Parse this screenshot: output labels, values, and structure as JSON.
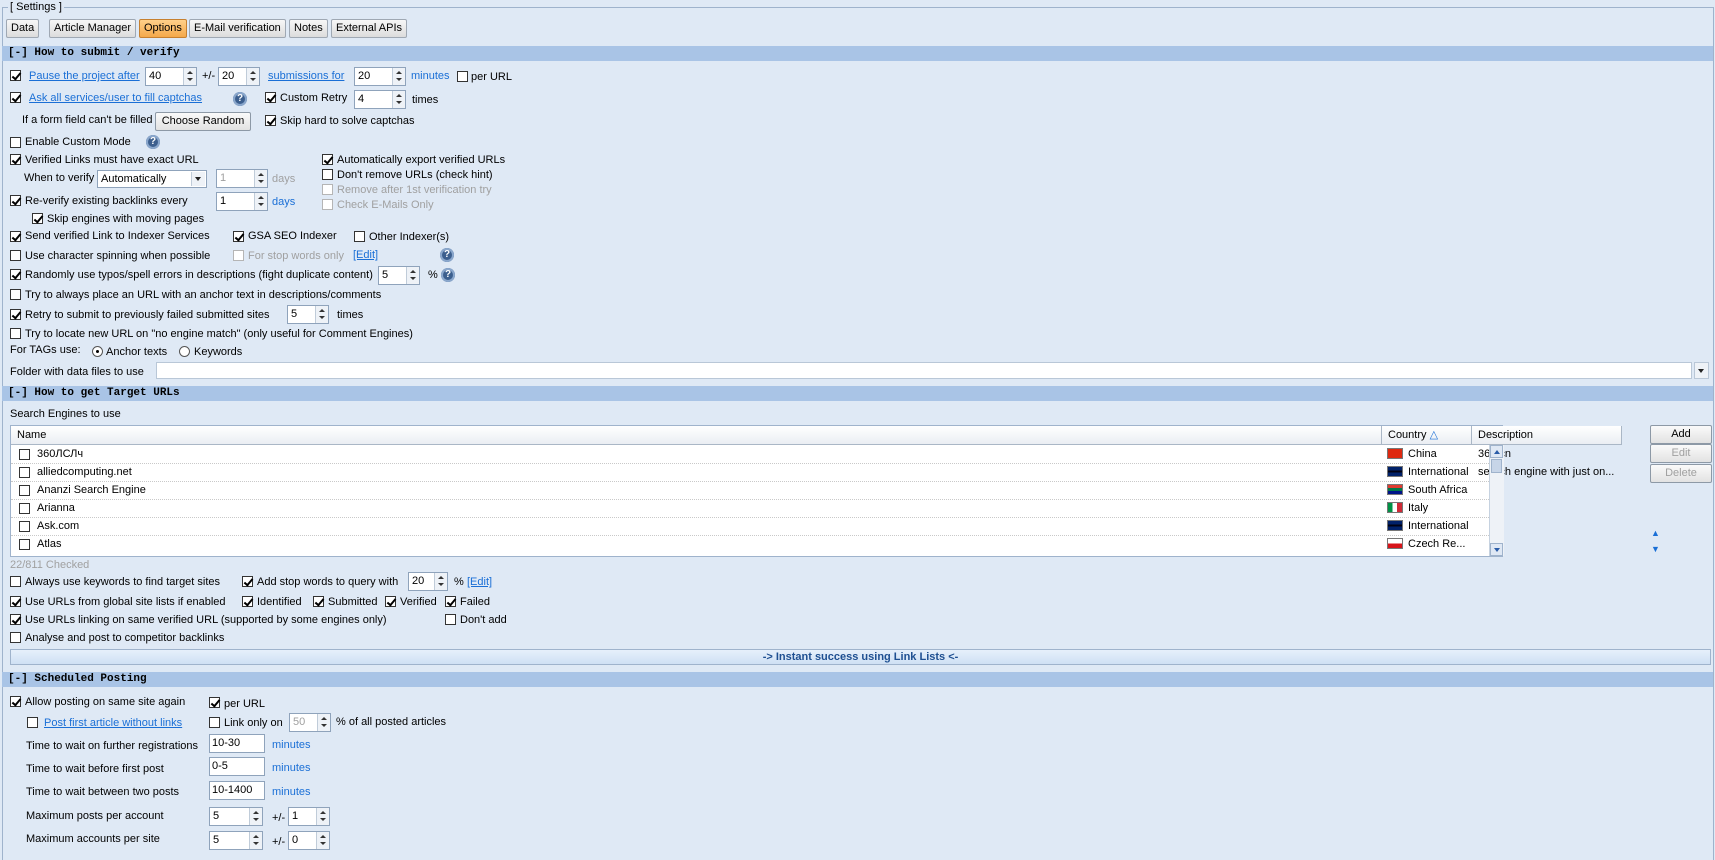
{
  "window": {
    "title": "[ Settings ]"
  },
  "tabs": [
    {
      "label": "Data",
      "active": false
    },
    {
      "label": "Article Manager",
      "active": false
    },
    {
      "label": "Options",
      "active": true
    },
    {
      "label": "E-Mail verification",
      "active": false
    },
    {
      "label": "Notes",
      "active": false
    },
    {
      "label": "External APIs",
      "active": false
    }
  ],
  "submit": {
    "header": "[-] How to submit / verify",
    "pause": {
      "label": "Pause the project after",
      "value": "40",
      "pm": "+/-",
      "pm_value": "20",
      "mid_label": "submissions for",
      "minutes_value": "20",
      "unit": "minutes",
      "per_url": "per URL"
    },
    "captcha": {
      "label": "Ask all services/user to fill captchas",
      "custom_retry": "Custom Retry",
      "retry_value": "4",
      "times": "times"
    },
    "form_field": {
      "label": "If a form field can't be filled",
      "button": "Choose Random",
      "skip_hard": "Skip hard to solve captchas"
    },
    "custom_mode": "Enable Custom Mode",
    "verified_exact": "Verified Links must have exact URL",
    "auto_export": "Automatically export verified URLs",
    "when_verify": {
      "label": "When to verify",
      "value": "Automatically",
      "days_value": "1",
      "days": "days"
    },
    "dont_remove": "Don't remove URLs (check hint)",
    "remove_after": "Remove after 1st verification try",
    "check_emails": "Check E-Mails Only",
    "reverify": {
      "label": "Re-verify existing backlinks every",
      "value": "1",
      "days": "days"
    },
    "skip_moving": "Skip engines with moving pages",
    "send_indexer": "Send verified Link to Indexer Services",
    "gsa_indexer": "GSA SEO Indexer",
    "other_indexer": "Other Indexer(s)",
    "char_spin": "Use character spinning when possible",
    "stop_words_only": "For stop words only",
    "edit": "[Edit]",
    "typos": {
      "label": "Randomly use typos/spell errors in descriptions (fight duplicate content)",
      "value": "5",
      "unit": "%"
    },
    "anchor_text": "Try to always place an URL with an anchor text in descriptions/comments",
    "retry_failed": {
      "label": "Retry to submit to previously failed submitted sites",
      "value": "5",
      "unit": "times"
    },
    "locate_new": "Try to locate new URL on \"no engine match\" (only useful for Comment Engines)",
    "tags": {
      "label": "For TAGs use:",
      "opt1": "Anchor texts",
      "opt2": "Keywords"
    },
    "folder_label": "Folder with data files to use"
  },
  "target": {
    "header": "[-] How to get Target URLs",
    "se_label": "Search Engines to use",
    "columns": {
      "name": "Name",
      "country": "Country",
      "sort_icon": "△",
      "description": "Description"
    },
    "rows": [
      {
        "name": "360ЛСЛч",
        "country": "China",
        "description": "360.cn",
        "flag": "cn"
      },
      {
        "name": "alliedcomputing.net",
        "country": "International",
        "description": "search engine with just on...",
        "flag": "gb"
      },
      {
        "name": "Ananzi Search Engine",
        "country": "South Africa",
        "description": "",
        "flag": "za"
      },
      {
        "name": "Arianna",
        "country": "Italy",
        "description": "",
        "flag": "it"
      },
      {
        "name": "Ask.com",
        "country": "International",
        "description": "",
        "flag": "gb"
      },
      {
        "name": "Atlas",
        "country": "Czech Re...",
        "description": "",
        "flag": "cz"
      }
    ],
    "buttons": {
      "add": "Add",
      "edit": "Edit",
      "delete": "Delete"
    },
    "checked": "22/811 Checked",
    "always_keywords": "Always use keywords to find target sites",
    "add_stop": {
      "label": "Add stop words to query with",
      "value": "20",
      "unit": "%",
      "edit": "[Edit]"
    },
    "global_lists": "Use URLs from global site lists if enabled",
    "identified": "Identified",
    "submitted": "Submitted",
    "verified": "Verified",
    "failed": "Failed",
    "linking_same": "Use URLs linking on same verified URL (supported by some engines only)",
    "dont_add": "Don't add",
    "competitor": "Analyse and post to competitor backlinks",
    "instant": "-> Instant success using Link Lists <-"
  },
  "sched": {
    "header": "[-] Scheduled Posting",
    "allow_same": "Allow posting on same site again",
    "per_url": "per URL",
    "post_first": "Post first article without links",
    "link_only": "Link only on",
    "link_only_value": "50",
    "link_only_suffix": "% of all posted articles",
    "reg_label": "Time to wait on further registrations",
    "reg_value": "10-30",
    "reg_unit": "minutes",
    "first_label": "Time to wait before first post",
    "first_value": "0-5",
    "first_unit": "minutes",
    "between_label": "Time to wait between two posts",
    "between_value": "10-1400",
    "between_unit": "minutes",
    "max_posts_label": "Maximum posts per account",
    "max_posts_value": "5",
    "max_posts_pm": "+/-",
    "max_posts_pm_value": "1",
    "max_accounts_label": "Maximum accounts per site",
    "max_accounts_value": "5",
    "max_accounts_pm": "+/-",
    "max_accounts_pm_value": "0"
  },
  "colors": {
    "section": "#a9c4e6",
    "link": "#1a6fd6",
    "active_tab": "#f4a84a",
    "background": "#dfe9f5"
  }
}
